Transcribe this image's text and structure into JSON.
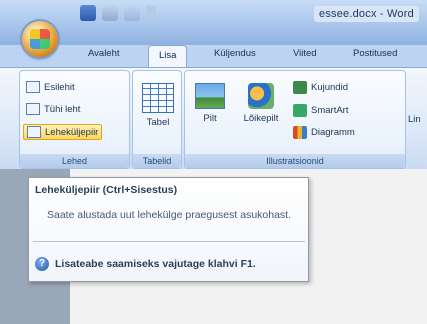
{
  "window": {
    "doc_title": "essee.docx - Word"
  },
  "tabs": [
    {
      "label": "Avaleht"
    },
    {
      "label": "Lisa"
    },
    {
      "label": "Küljendus"
    },
    {
      "label": "Viited"
    },
    {
      "label": "Postitused"
    }
  ],
  "ribbon": {
    "pages_group": {
      "items": [
        "Esilehit",
        "Tühi leht",
        "Leheküljepiir"
      ],
      "label": "Lehed"
    },
    "tables_group": {
      "button": "Tabel",
      "label": "Tabelid"
    },
    "illustrations_group": {
      "picture": "Pilt",
      "clipart": "Lõikepilt",
      "shapes": "Kujundid",
      "smartart": "SmartArt",
      "chart": "Diagramm",
      "label": "Illustratsioonid"
    },
    "next_group_peek": "Lin"
  },
  "tooltip": {
    "title": "Leheküljepiir (Ctrl+Sisestus)",
    "body": "Saate alustada uut lehekülge praegusest asukohast.",
    "help": "Lisateabe saamiseks vajutage klahvi F1."
  },
  "colors": {
    "ribbon_blue": "#bcd3f1",
    "highlight": "#ffd55a"
  }
}
